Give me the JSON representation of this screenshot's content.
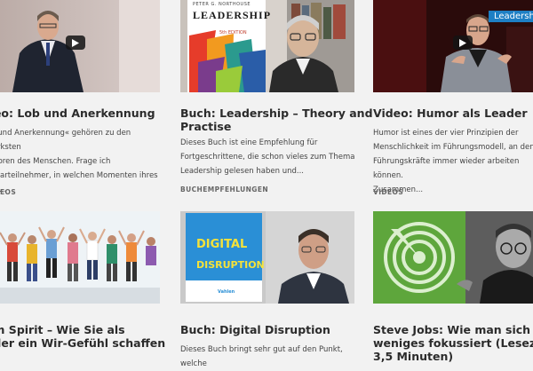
{
  "cards": [
    {
      "title": "deo: Lob und Anerkennung",
      "excerpt": "ob und Anerkennung« gehören zu den stärksten\nvatoren des Menschen. Frage ich\nminarteilnehmer, in welchen Momenten ihres\nens...",
      "category": "VIDEOS"
    },
    {
      "title": "Buch: Leadership – Theory and\nPractise",
      "excerpt": "Dieses Buch ist eine Empfehlung für\nFortgeschrittene, die schon vieles zum Thema\nLeadership gelesen haben und...",
      "category": "BUCHEMPFEHLUNGEN",
      "book_title": "LEADERSHIP",
      "book_author": "PETER G. NORTHOUSE",
      "book_edition": "5th EDITION"
    },
    {
      "title": "Video: Humor als Leader",
      "excerpt": "Humor ist eines der vier Prinzipien der\nMenschlichkeit im Führungsmodell, an denen\nFührungskräfte immer wieder arbeiten können.\nZusammen...",
      "category": "VIDEOS",
      "overlay_label": "Leadership"
    },
    {
      "title": "am Spirit – Wie Sie als\nader ein Wir-Gefühl schaffen",
      "excerpt": "",
      "category": ""
    },
    {
      "title": "Buch: Digital Disruption",
      "excerpt": "Dieses Buch bringt sehr gut auf den Punkt, welche",
      "category": "",
      "book_line1": "DIGITAL",
      "book_line2": "DISRUPTION",
      "book_publisher": "Vahlen"
    },
    {
      "title": "Steve Jobs: Wie man sich auf\nweniges fokussiert (Lesezeit:\n3,5 Minuten)",
      "excerpt": "",
      "category": ""
    }
  ],
  "icons": {
    "play": "play-icon"
  },
  "colors": {
    "background": "#f2f2f2",
    "title": "#2b2b2b",
    "leadership_label": "#1e7fc4",
    "digital_book": "#2a8fd6",
    "digital_text": "#f5e23a"
  }
}
